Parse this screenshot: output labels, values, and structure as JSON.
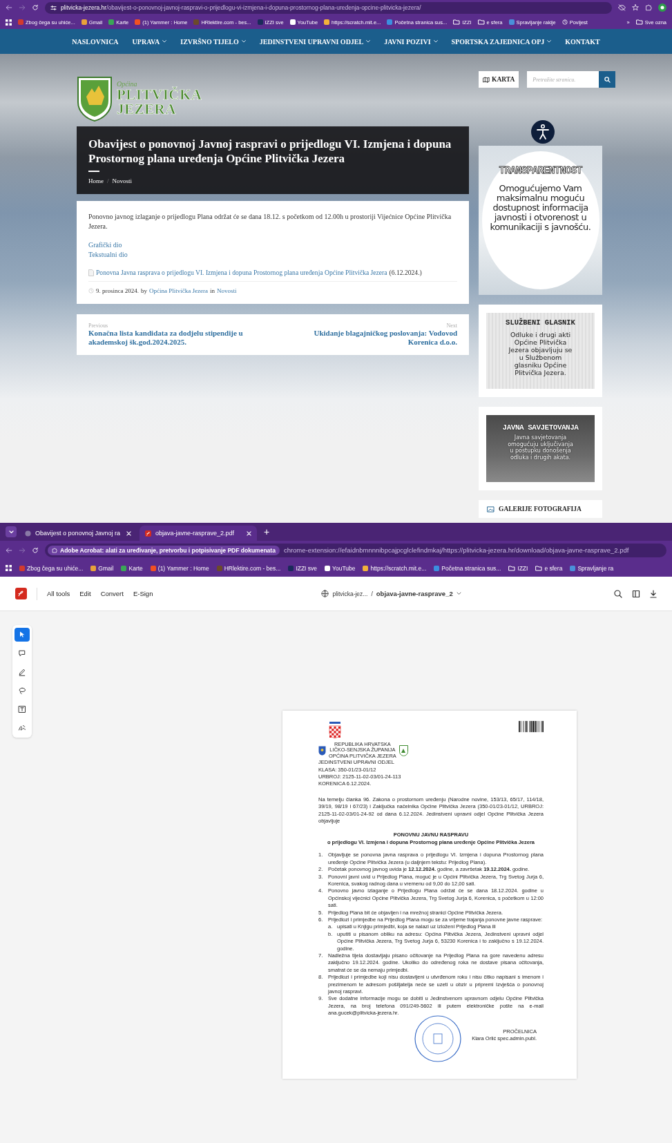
{
  "browser_top": {
    "url_host": "plitvicka-jezera.hr",
    "url_path": "/obavijest-o-ponovnoj-javnoj-raspravi-o-prijedlogu-vi-izmjena-i-dopuna-prostornog-plana-uredenja-opcine-plitvicka-jezera/",
    "bookmarks": [
      {
        "label": "Zbog čega su uhiće...",
        "kind": "site",
        "color": "#d23a2e"
      },
      {
        "label": "Gmail",
        "kind": "site",
        "color": "#e8a23a"
      },
      {
        "label": "Karte",
        "kind": "site",
        "color": "#3aa757"
      },
      {
        "label": "(1) Yammer : Home",
        "kind": "site",
        "color": "#f25022"
      },
      {
        "label": "HRlektire.com - bes...",
        "kind": "site",
        "color": "#6b4a2a"
      },
      {
        "label": "IZZI sve",
        "kind": "site",
        "color": "#1a2a5a"
      },
      {
        "label": "YouTube",
        "kind": "site",
        "color": "#ffffff"
      },
      {
        "label": "https://scratch.mit.e...",
        "kind": "site",
        "color": "#f3b23a"
      },
      {
        "label": "Početna stranica sus...",
        "kind": "site",
        "color": "#3b8fe0"
      },
      {
        "label": "IZZI",
        "kind": "folder"
      },
      {
        "label": "e sfera",
        "kind": "folder"
      },
      {
        "label": "Spravljanje rakije",
        "kind": "site",
        "color": "#4a90d9"
      },
      {
        "label": "Povijest",
        "kind": "history"
      }
    ],
    "overflow": "»",
    "all_bookmarks": "Sve ozna"
  },
  "site": {
    "nav": [
      {
        "label": "NASLOVNICA",
        "dropdown": false
      },
      {
        "label": "UPRAVA",
        "dropdown": true
      },
      {
        "label": "IZVRŠNO TIJELO",
        "dropdown": true
      },
      {
        "label": "JEDINSTVENI UPRAVNI ODJEL",
        "dropdown": true
      },
      {
        "label": "JAVNI POZIVI",
        "dropdown": true
      },
      {
        "label": "SPORTSKA ZAJEDNICA OPJ",
        "dropdown": true
      },
      {
        "label": "KONTAKT",
        "dropdown": false
      }
    ],
    "logo": {
      "small": "Općina",
      "line1": "PLITVIČKA",
      "line2": "JEZERA"
    },
    "map_button": "KARTA",
    "search": {
      "placeholder": "Pretražite stranicu."
    },
    "article": {
      "title": "Obavijest o ponovnoj Javnoj raspravi o prijedlogu VI. Izmjena i dopuna Prostornog plana uređenja Općine Plitvička Jezera",
      "breadcrumbs": [
        "Home",
        "Novosti"
      ],
      "separator": "/",
      "body": "Ponovno javnog izlaganje o prijedlogu Plana održat će se dana 18.12. s početkom od 12.00h u prostoriji Vijećnice Općine Plitvička Jezera.",
      "links": [
        "Grafički dio",
        "Tekstualni dio"
      ],
      "attachment": {
        "link": "Ponovna Javna rasprava o prijedlogu VI. Izmjena i dopuna Prostornog plana uređenja Općine Plitvička Jezera",
        "date": "(6.12.2024.)"
      },
      "meta": {
        "date": "9. prosinca 2024.",
        "by": "by",
        "author": "Općina Plitvička Jezera",
        "in": "in",
        "category": "Novosti"
      }
    },
    "post_nav": {
      "previous": {
        "label": "Previous",
        "title": "Konačna lista kandidata za dodjelu stipendije u akademskoj šk.god.2024.2025."
      },
      "next": {
        "label": "Next",
        "title": "Ukidanje blagajničkog poslovanja: Vodovod Korenica d.o.o."
      }
    },
    "sidebar": [
      {
        "kind": "transparency",
        "heading": "TRANSPARENTNOST",
        "text": "Omogućujemo Vam maksimalnu moguću dostupnost informacija javnosti i otvorenost u komunikaciji s javnošću."
      },
      {
        "kind": "gazette",
        "heading": "SLUŽBENI GLASNIK",
        "text": "Odluke i drugi akti Općine Plitvička Jezera objavljuju se u Službenom glasniku Općine Plitvička Jezera."
      },
      {
        "kind": "consultation",
        "heading": "JAVNA SAVJETOVANJA",
        "text": "Javna savjetovanja omogućuju uključivanja u postupku donošenja odluka i drugih akata."
      },
      {
        "kind": "gallery",
        "heading": "GALERIJE FOTOGRAFIJA"
      }
    ]
  },
  "browser_pdf": {
    "tabs": [
      {
        "title": "Obavijest o ponovnoj Javnoj ra",
        "kind": "web",
        "selected": false
      },
      {
        "title": "objava-javne-rasprave_2.pdf",
        "kind": "pdf",
        "selected": true
      }
    ],
    "new_tab": "+",
    "extension_chip": "Adobe Acrobat: alati za uređivanje, pretvorbu i potpisivanje PDF dokumenata",
    "url": "chrome-extension://efaidnbmnnnibpcajpcglclefindmkaj/https://plitvicka-jezera.hr/download/objava-javne-rasprave_2.pdf",
    "bookmarks": [
      {
        "label": "Zbog čega su uhiće...",
        "kind": "site",
        "color": "#d23a2e"
      },
      {
        "label": "Gmail",
        "kind": "site",
        "color": "#e8a23a"
      },
      {
        "label": "Karte",
        "kind": "site",
        "color": "#3aa757"
      },
      {
        "label": "(1) Yammer : Home",
        "kind": "site",
        "color": "#f25022"
      },
      {
        "label": "HRlektire.com - bes...",
        "kind": "site",
        "color": "#6b4a2a"
      },
      {
        "label": "IZZI sve",
        "kind": "site",
        "color": "#1a2a5a"
      },
      {
        "label": "YouTube",
        "kind": "site",
        "color": "#ffffff"
      },
      {
        "label": "https://scratch.mit.e...",
        "kind": "site",
        "color": "#f3b23a"
      },
      {
        "label": "Početna stranica sus...",
        "kind": "site",
        "color": "#3b8fe0"
      },
      {
        "label": "IZZI",
        "kind": "folder"
      },
      {
        "label": "e sfera",
        "kind": "folder"
      },
      {
        "label": "Spravljanje ra",
        "kind": "site",
        "color": "#4a90d9"
      }
    ],
    "acrobat": {
      "menu": [
        "All tools",
        "Edit",
        "Convert",
        "E-Sign"
      ],
      "file_host": "plitvicka-jez...",
      "separator": "/",
      "file_name": "objava-javne-rasprave_2"
    },
    "tools": [
      {
        "kind": "select",
        "selected": true
      },
      {
        "kind": "comment",
        "selected": false
      },
      {
        "kind": "draw",
        "selected": false
      },
      {
        "kind": "lasso",
        "selected": false
      },
      {
        "kind": "text",
        "selected": false
      },
      {
        "kind": "sign",
        "selected": false
      }
    ],
    "pdf": {
      "authority": [
        "REPUBLIKA HRVATSKA",
        "LIČKO-SENJSKA ŽUPANIJA",
        "OPĆINA PLITVIČKA JEZERA"
      ],
      "header_lines": [
        "JEDINSTVENI UPRAVNI ODJEL",
        "KLASA: 350-01/23-01/12",
        "URBROJ: 2125-11-02-03/01-24-113",
        "KORENICA 6.12.2024."
      ],
      "intro": "Na temelju članka 96. Zakona o prostornom uređenju (Narodne novine, 153/13, 65/17, 114/18, 39/19,  98/19 i 67/23) i Zaključka načelnika Općine Plitvička Jezera (350-01/23-01/12, URBROJ: 2125-11-02-03/01-24-92 od dana 6.12.2024. Jedinstveni upravni odjel Općine Plitvička Jezera objavljuje",
      "title": "PONOVNU JAVNU RASPRAVU",
      "subtitle": "o prijedlogu VI. Izmjena i dopuna  Prostornog plana uređenje Općine Plitvička Jezera",
      "items": [
        {
          "number": "1.",
          "text": "Objavljuje se ponovna javna rasprava o prijedlogu VI. Izmjena i dopuna  Prostornog plana uređenje Općine Plitvička Jezera (u daljnjem tekstu: Prijedlog Plana)."
        },
        {
          "number": "2.",
          "text": "Početak ponovnog javnog uvida je **12.12.2024.** godine, a završetak **19.12.2024.** godine."
        },
        {
          "number": "3.",
          "text": "Ponovni javni uvid u Prijedlog Plana, moguć je u Općini Plitvička Jezera, Trg Svetog Jurja 6, Korenica, svakog radnog dana u vremenu od 9,00 do 12,00 sati."
        },
        {
          "number": "4.",
          "text": "Ponovno javno izlaganje o Prijedlogu Plana održat će se dana 18.12.2024. godine u Općinskoj vijećnici Općine Plitvička Jezera, Trg Svetog Jurja 6, Korenica, s početkom u 12:00 sati."
        },
        {
          "number": "5.",
          "text": "Prijedlog Plana bit će objavljen i na mrežnoj stranici Općine Plitvička Jezera."
        },
        {
          "number": "6.",
          "text": "Prijedlozi i primjedbe na Prijedlog Plana mogu se za vrijeme trajanja ponovne javne rasprave:",
          "children": [
            {
              "number": "a.",
              "text": "upisati u Knjigu primjedbi, koja se nalazi uz izloženi Prijedlog Plana ili"
            },
            {
              "number": "b.",
              "text": "uputiti u pisanom obliku na adresu: Općina Plitvička Jezera, Jedinstveni upravni odjel Općine Plitvička Jezera, Trg Svetog Jurja 6, 53230 Korenica i to zaključno s 19.12.2024. godine."
            }
          ]
        },
        {
          "number": "7.",
          "text": "Nadležna tijela dostavljaju pisano očitovanje na Prijedlog Plana na gore navedenu adresu zaključno 19.12.2024. godine. Ukoliko do određenog roka ne dostave pisana očitovanja, smatrat će se da nemaju primjedbi."
        },
        {
          "number": "8.",
          "text": "Prijedlozi i primjedbe koji nisu dostavljeni u utvrđenom roku i nisu čitko napisani s imenom i prezimenom te adresom pošiljatelja neće se uzeti u obzir u pripremi Izvješća o ponovnoj javnoj raspravi."
        },
        {
          "number": "9.",
          "text": "Sve dodatne informacije mogu se dobiti u Jedinstvenom upravnom odjelu Općine Plitvička Jezera, na broj telefona 091/249-5602 ili putem elektroničke pošte na e-mail ana.gucek@plitvicka-jezera.hr."
        }
      ],
      "signature": {
        "role": "PROČELNICA",
        "name": "Klara Orlić spec.admin.publ."
      }
    }
  }
}
